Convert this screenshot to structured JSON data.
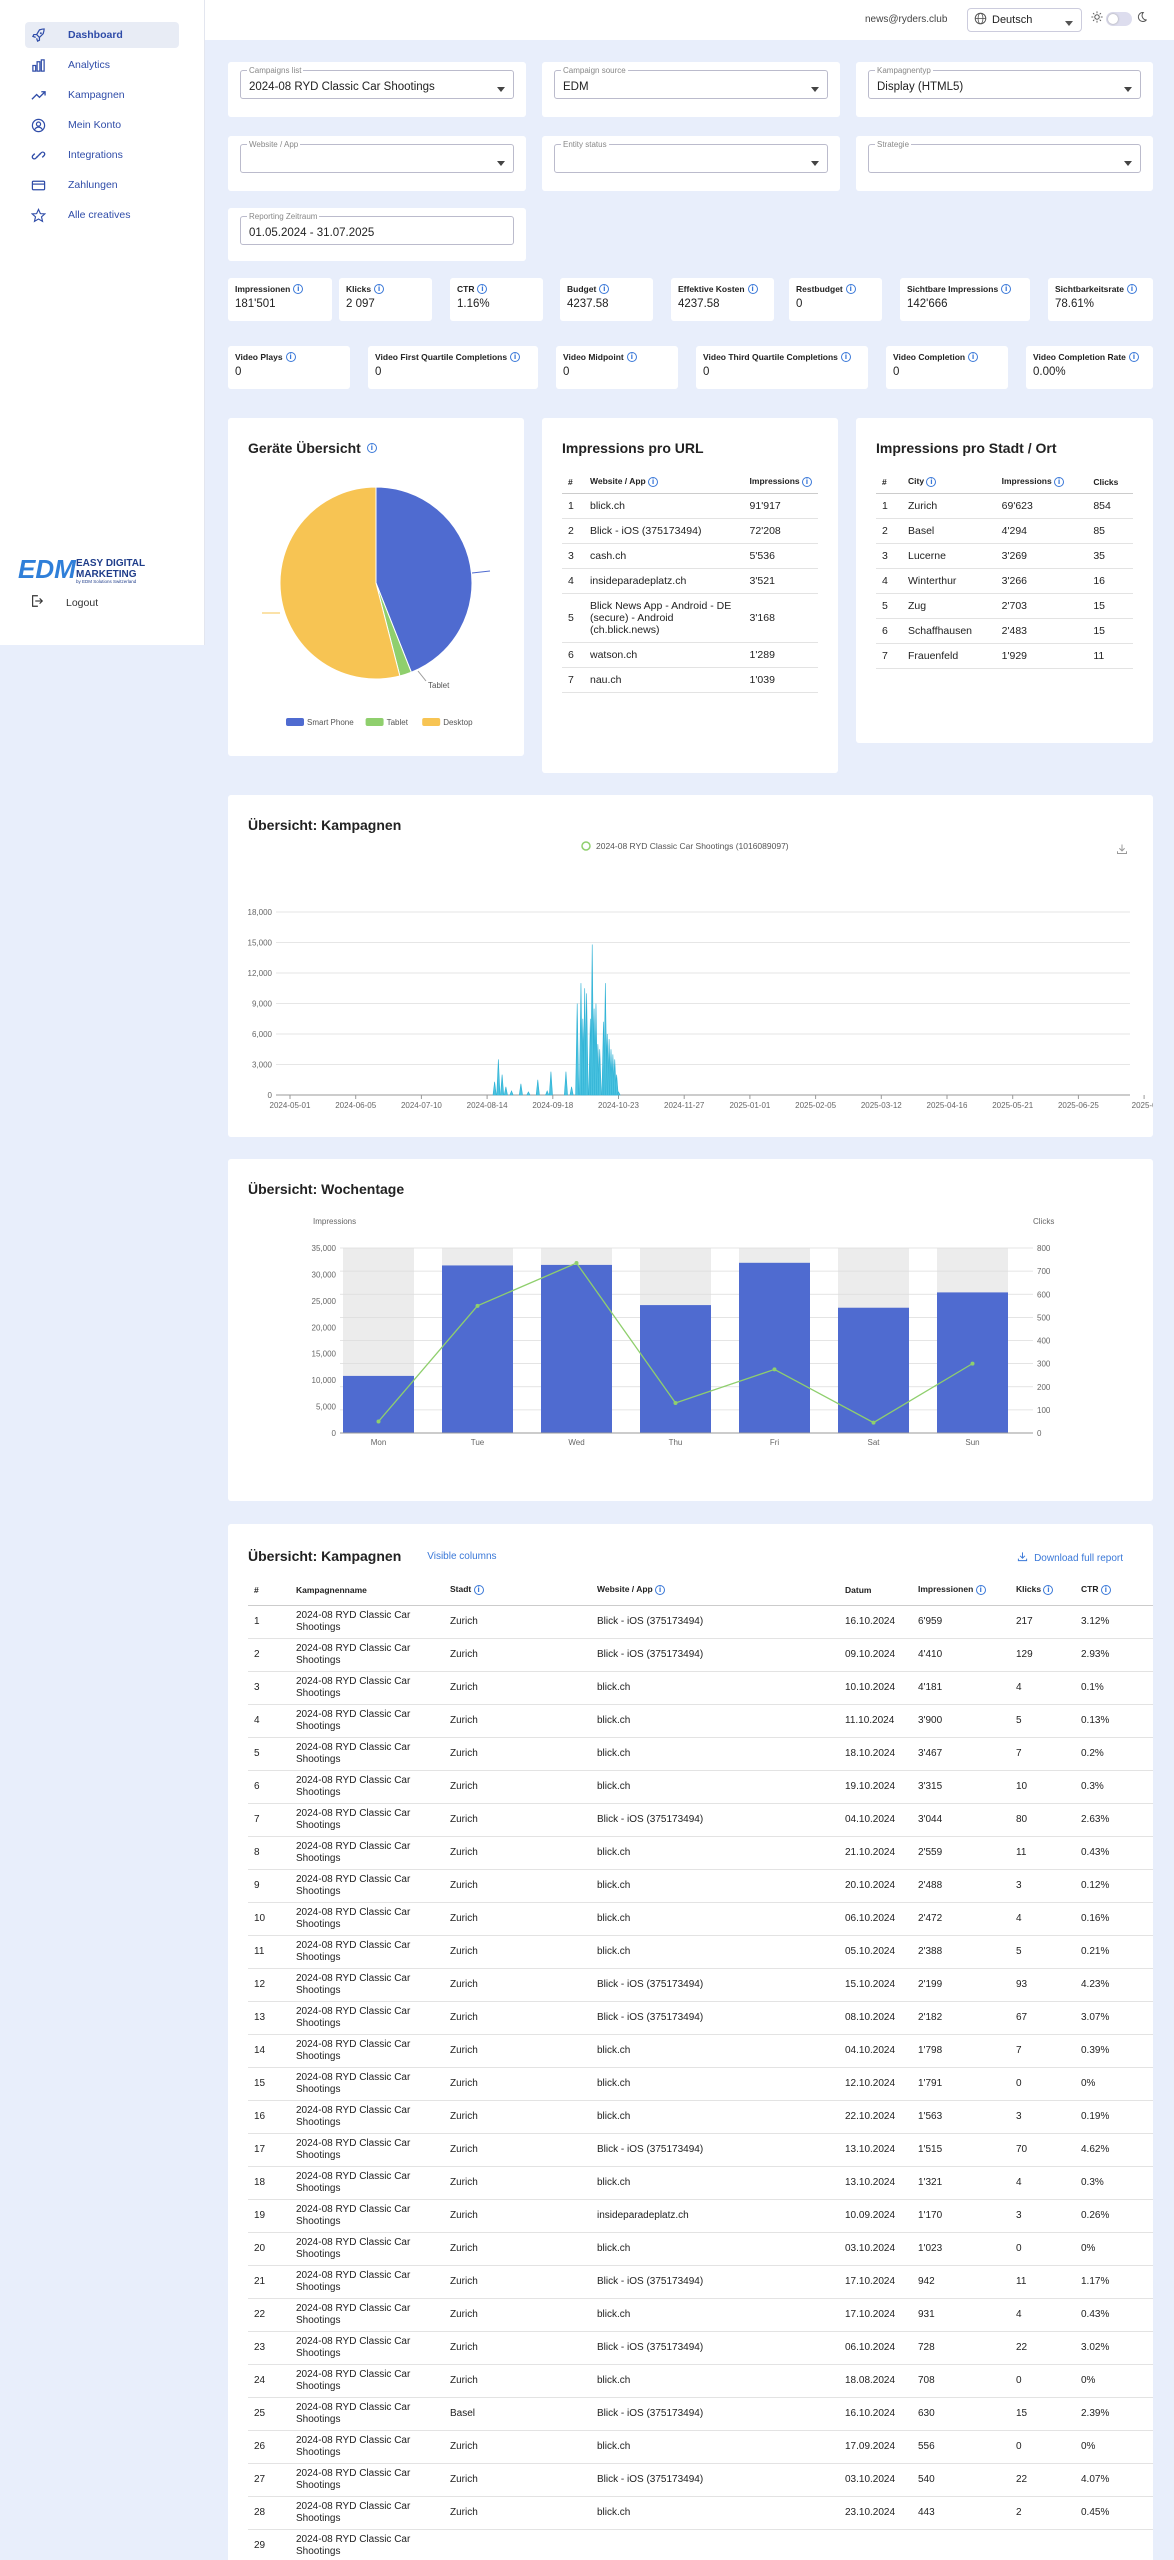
{
  "user": {
    "email": "news@ryders.club"
  },
  "language": {
    "value": "Deutsch"
  },
  "sidebar": {
    "items": [
      {
        "label": "Dashboard",
        "icon": "rocket-icon",
        "active": true
      },
      {
        "label": "Analytics",
        "icon": "bar-chart-icon"
      },
      {
        "label": "Kampagnen",
        "icon": "trend-icon"
      },
      {
        "label": "Mein Konto",
        "icon": "user-circle-icon"
      },
      {
        "label": "Integrations",
        "icon": "link-icon"
      },
      {
        "label": "Zahlungen",
        "icon": "credit-card-icon"
      },
      {
        "label": "Alle creatives",
        "icon": "star-icon"
      }
    ],
    "logo": {
      "main": "EDM",
      "line1": "EASY DIGITAL",
      "line2": "MARKETING",
      "sub": "by EDM Solutions Switzerland"
    },
    "logout": "Logout"
  },
  "filters": {
    "campaign_list": {
      "label": "Campaigns list",
      "value": "2024-08 RYD Classic Car Shootings"
    },
    "campaign_source": {
      "label": "Campaign source",
      "value": "EDM"
    },
    "campaign_type": {
      "label": "Kampagnentyp",
      "value": "Display (HTML5)"
    },
    "website": {
      "label": "Website / App",
      "value": ""
    },
    "entity_status": {
      "label": "Entity status",
      "value": ""
    },
    "strategy": {
      "label": "Strategie",
      "value": ""
    },
    "period": {
      "label": "Reporting Zeitraum",
      "value": "01.05.2024 - 31.07.2025"
    }
  },
  "metrics": [
    {
      "label": "Impressionen",
      "value": "181'501"
    },
    {
      "label": "Klicks",
      "value": "2 097"
    },
    {
      "label": "CTR",
      "value": "1.16%"
    },
    {
      "label": "Budget",
      "value": "4237.58"
    },
    {
      "label": "Effektive Kosten",
      "value": "4237.58"
    },
    {
      "label": "Restbudget",
      "value": "0"
    },
    {
      "label": "Sichtbare Impressions",
      "value": "142'666"
    },
    {
      "label": "Sichtbarkeitsrate",
      "value": "78.61%"
    }
  ],
  "video_metrics": [
    {
      "label": "Video Plays",
      "value": "0"
    },
    {
      "label": "Video First Quartile Completions",
      "value": "0"
    },
    {
      "label": "Video Midpoint",
      "value": "0"
    },
    {
      "label": "Video Third Quartile Completions",
      "value": "0"
    },
    {
      "label": "Video Completion",
      "value": "0"
    },
    {
      "label": "Video Completion Rate",
      "value": "0.00%"
    }
  ],
  "devices": {
    "title": "Geräte Übersicht",
    "chart_data": {
      "type": "pie",
      "slices": [
        {
          "name": "Smart Phone",
          "value": 44,
          "color": "#4f6bd0"
        },
        {
          "name": "Tablet",
          "value": 2,
          "color": "#8fcf6d"
        },
        {
          "name": "Desktop",
          "value": 54,
          "color": "#f7c453"
        }
      ],
      "annotation": "Tablet"
    }
  },
  "url_table": {
    "title": "Impressions pro URL",
    "headers": [
      "#",
      "Website / App",
      "Impressions"
    ],
    "rows": [
      [
        "1",
        "blick.ch",
        "91'917"
      ],
      [
        "2",
        "Blick - iOS (375173494)",
        "72'208"
      ],
      [
        "3",
        "cash.ch",
        "5'536"
      ],
      [
        "4",
        "insideparadeplatz.ch",
        "3'521"
      ],
      [
        "5",
        "Blick News App - Android - DE (secure) - Android (ch.blick.news)",
        "3'168"
      ],
      [
        "6",
        "watson.ch",
        "1'289"
      ],
      [
        "7",
        "nau.ch",
        "1'039"
      ]
    ]
  },
  "city_table": {
    "title": "Impressions pro Stadt / Ort",
    "headers": [
      "#",
      "City",
      "Impressions",
      "Clicks"
    ],
    "rows": [
      [
        "1",
        "Zurich",
        "69'623",
        "854"
      ],
      [
        "2",
        "Basel",
        "4'294",
        "85"
      ],
      [
        "3",
        "Lucerne",
        "3'269",
        "35"
      ],
      [
        "4",
        "Winterthur",
        "3'266",
        "16"
      ],
      [
        "5",
        "Zug",
        "2'703",
        "15"
      ],
      [
        "6",
        "Schaffhausen",
        "2'483",
        "15"
      ],
      [
        "7",
        "Frauenfeld",
        "1'929",
        "11"
      ]
    ]
  },
  "campaign_chart": {
    "title": "Übersicht: Kampagnen",
    "chart_data": {
      "type": "area",
      "legend": "2024-08 RYD Classic Car Shootings (1016089097)",
      "ylim": [
        0,
        18000
      ],
      "yticks": [
        "0",
        "3,000",
        "6,000",
        "9,000",
        "12,000",
        "15,000",
        "18,000"
      ],
      "xticks": [
        "2024-05-01",
        "2024-06-05",
        "2024-07-10",
        "2024-08-14",
        "2024-09-18",
        "2024-10-23",
        "2024-11-27",
        "2025-01-01",
        "2025-02-05",
        "2025-03-12",
        "2025-04-16",
        "2025-05-21",
        "2025-06-25",
        "2025-0"
      ],
      "x": [
        "2024-08-18",
        "2024-08-20",
        "2024-08-22",
        "2024-08-24",
        "2024-08-27",
        "2024-09-01",
        "2024-09-05",
        "2024-09-10",
        "2024-09-15",
        "2024-09-17",
        "2024-09-25",
        "2024-09-28",
        "2024-10-01",
        "2024-10-03",
        "2024-10-04",
        "2024-10-05",
        "2024-10-06",
        "2024-10-08",
        "2024-10-09",
        "2024-10-10",
        "2024-10-11",
        "2024-10-12",
        "2024-10-13",
        "2024-10-15",
        "2024-10-16",
        "2024-10-17",
        "2024-10-18",
        "2024-10-19",
        "2024-10-20",
        "2024-10-21",
        "2024-10-22",
        "2024-10-23"
      ],
      "values": [
        1300,
        3500,
        2000,
        800,
        400,
        1100,
        300,
        1500,
        400,
        2300,
        2300,
        800,
        9000,
        11000,
        7500,
        10500,
        10000,
        7500,
        14800,
        8500,
        9000,
        5000,
        4500,
        7200,
        11000,
        6000,
        5500,
        4500,
        4000,
        3500,
        2000,
        300
      ]
    }
  },
  "weekday_chart": {
    "title": "Übersicht: Wochentage",
    "chart_data": {
      "type": "bar",
      "categories": [
        "Mon",
        "Tue",
        "Wed",
        "Thu",
        "Fri",
        "Sat",
        "Sun"
      ],
      "series": [
        {
          "name": "Impressions",
          "values": [
            10800,
            31700,
            31800,
            24200,
            32200,
            23700,
            26600
          ],
          "color": "#4f6bd0",
          "axis": "left"
        },
        {
          "name": "Clicks",
          "values": [
            50,
            550,
            735,
            130,
            275,
            45,
            300
          ],
          "color": "#8fcf6d",
          "axis": "right"
        }
      ],
      "ylabel": "Impressions",
      "y2label": "Clicks",
      "ylim": [
        0,
        35000
      ],
      "y2lim": [
        0,
        800
      ],
      "yticks": [
        "0",
        "5,000",
        "10,000",
        "15,000",
        "20,000",
        "25,000",
        "30,000",
        "35,000"
      ],
      "y2ticks": [
        "0",
        "100",
        "200",
        "300",
        "400",
        "500",
        "600",
        "700",
        "800"
      ]
    }
  },
  "campaign_table": {
    "title": "Übersicht: Kampagnen",
    "visible_columns": "Visible columns",
    "download": "Download full report",
    "headers": [
      "#",
      "Kampagnenname",
      "Stadt",
      "Website / App",
      "Datum",
      "Impressionen",
      "Klicks",
      "CTR"
    ],
    "rows": [
      [
        "1",
        "2024-08 RYD Classic Car Shootings",
        "Zurich",
        "Blick - iOS (375173494)",
        "16.10.2024",
        "6'959",
        "217",
        "3.12%"
      ],
      [
        "2",
        "2024-08 RYD Classic Car Shootings",
        "Zurich",
        "Blick - iOS (375173494)",
        "09.10.2024",
        "4'410",
        "129",
        "2.93%"
      ],
      [
        "3",
        "2024-08 RYD Classic Car Shootings",
        "Zurich",
        "blick.ch",
        "10.10.2024",
        "4'181",
        "4",
        "0.1%"
      ],
      [
        "4",
        "2024-08 RYD Classic Car Shootings",
        "Zurich",
        "blick.ch",
        "11.10.2024",
        "3'900",
        "5",
        "0.13%"
      ],
      [
        "5",
        "2024-08 RYD Classic Car Shootings",
        "Zurich",
        "blick.ch",
        "18.10.2024",
        "3'467",
        "7",
        "0.2%"
      ],
      [
        "6",
        "2024-08 RYD Classic Car Shootings",
        "Zurich",
        "blick.ch",
        "19.10.2024",
        "3'315",
        "10",
        "0.3%"
      ],
      [
        "7",
        "2024-08 RYD Classic Car Shootings",
        "Zurich",
        "Blick - iOS (375173494)",
        "04.10.2024",
        "3'044",
        "80",
        "2.63%"
      ],
      [
        "8",
        "2024-08 RYD Classic Car Shootings",
        "Zurich",
        "blick.ch",
        "21.10.2024",
        "2'559",
        "11",
        "0.43%"
      ],
      [
        "9",
        "2024-08 RYD Classic Car Shootings",
        "Zurich",
        "blick.ch",
        "20.10.2024",
        "2'488",
        "3",
        "0.12%"
      ],
      [
        "10",
        "2024-08 RYD Classic Car Shootings",
        "Zurich",
        "blick.ch",
        "06.10.2024",
        "2'472",
        "4",
        "0.16%"
      ],
      [
        "11",
        "2024-08 RYD Classic Car Shootings",
        "Zurich",
        "blick.ch",
        "05.10.2024",
        "2'388",
        "5",
        "0.21%"
      ],
      [
        "12",
        "2024-08 RYD Classic Car Shootings",
        "Zurich",
        "Blick - iOS (375173494)",
        "15.10.2024",
        "2'199",
        "93",
        "4.23%"
      ],
      [
        "13",
        "2024-08 RYD Classic Car Shootings",
        "Zurich",
        "Blick - iOS (375173494)",
        "08.10.2024",
        "2'182",
        "67",
        "3.07%"
      ],
      [
        "14",
        "2024-08 RYD Classic Car Shootings",
        "Zurich",
        "blick.ch",
        "04.10.2024",
        "1'798",
        "7",
        "0.39%"
      ],
      [
        "15",
        "2024-08 RYD Classic Car Shootings",
        "Zurich",
        "blick.ch",
        "12.10.2024",
        "1'791",
        "0",
        "0%"
      ],
      [
        "16",
        "2024-08 RYD Classic Car Shootings",
        "Zurich",
        "blick.ch",
        "22.10.2024",
        "1'563",
        "3",
        "0.19%"
      ],
      [
        "17",
        "2024-08 RYD Classic Car Shootings",
        "Zurich",
        "Blick - iOS (375173494)",
        "13.10.2024",
        "1'515",
        "70",
        "4.62%"
      ],
      [
        "18",
        "2024-08 RYD Classic Car Shootings",
        "Zurich",
        "blick.ch",
        "13.10.2024",
        "1'321",
        "4",
        "0.3%"
      ],
      [
        "19",
        "2024-08 RYD Classic Car Shootings",
        "Zurich",
        "insideparadeplatz.ch",
        "10.09.2024",
        "1'170",
        "3",
        "0.26%"
      ],
      [
        "20",
        "2024-08 RYD Classic Car Shootings",
        "Zurich",
        "blick.ch",
        "03.10.2024",
        "1'023",
        "0",
        "0%"
      ],
      [
        "21",
        "2024-08 RYD Classic Car Shootings",
        "Zurich",
        "Blick - iOS (375173494)",
        "17.10.2024",
        "942",
        "11",
        "1.17%"
      ],
      [
        "22",
        "2024-08 RYD Classic Car Shootings",
        "Zurich",
        "blick.ch",
        "17.10.2024",
        "931",
        "4",
        "0.43%"
      ],
      [
        "23",
        "2024-08 RYD Classic Car Shootings",
        "Zurich",
        "Blick - iOS (375173494)",
        "06.10.2024",
        "728",
        "22",
        "3.02%"
      ],
      [
        "24",
        "2024-08 RYD Classic Car Shootings",
        "Zurich",
        "blick.ch",
        "18.08.2024",
        "708",
        "0",
        "0%"
      ],
      [
        "25",
        "2024-08 RYD Classic Car Shootings",
        "Basel",
        "Blick - iOS (375173494)",
        "16.10.2024",
        "630",
        "15",
        "2.39%"
      ],
      [
        "26",
        "2024-08 RYD Classic Car Shootings",
        "Zurich",
        "blick.ch",
        "17.09.2024",
        "556",
        "0",
        "0%"
      ],
      [
        "27",
        "2024-08 RYD Classic Car Shootings",
        "Zurich",
        "Blick - iOS (375173494)",
        "03.10.2024",
        "540",
        "22",
        "4.07%"
      ],
      [
        "28",
        "2024-08 RYD Classic Car Shootings",
        "Zurich",
        "blick.ch",
        "23.10.2024",
        "443",
        "2",
        "0.45%"
      ],
      [
        "29",
        "2024-08 RYD Classic Car Shootings",
        "",
        "",
        "",
        "",
        "",
        ""
      ]
    ]
  }
}
